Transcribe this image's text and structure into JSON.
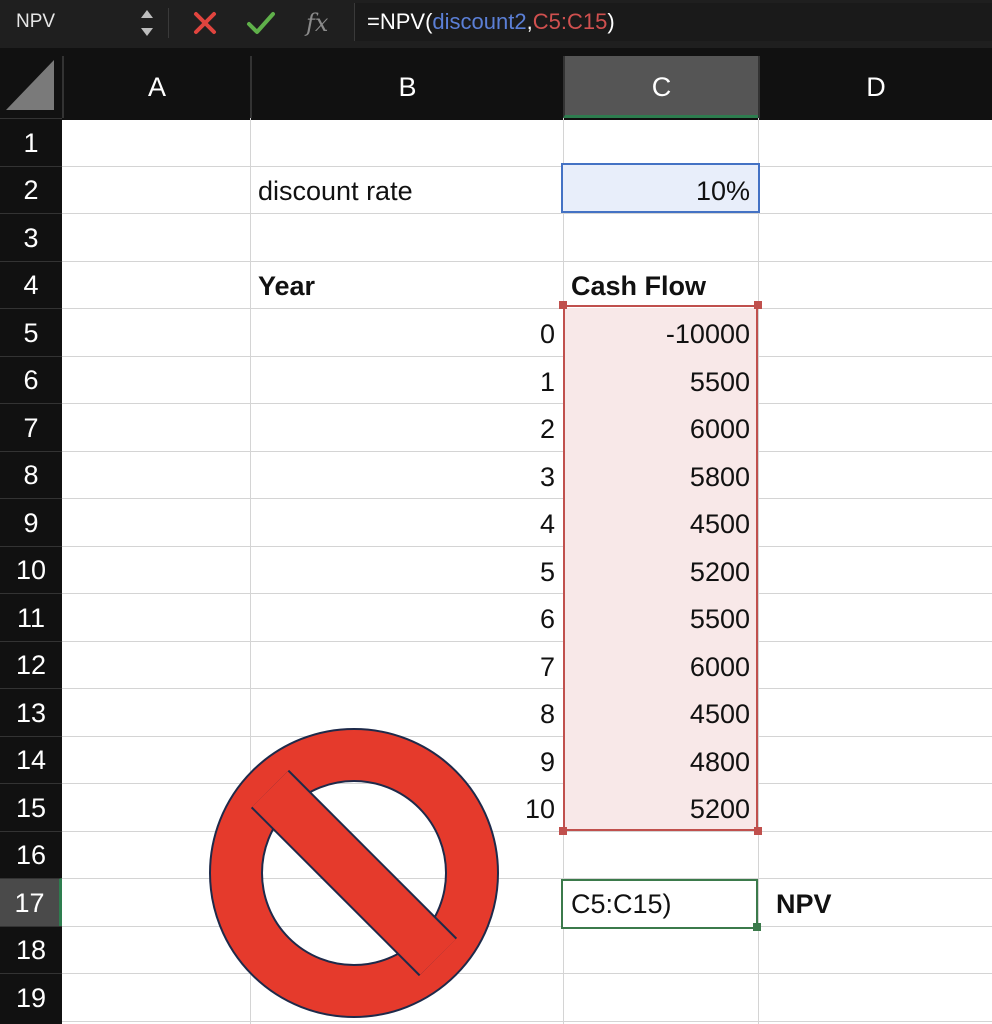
{
  "formula_bar": {
    "name_box": "NPV",
    "formula_prefix": "=NPV(",
    "formula_arg1": "discount2",
    "formula_comma": ",",
    "formula_arg2": "C5:C15",
    "formula_suffix": ")",
    "fx_label": "fx"
  },
  "columns": [
    "A",
    "B",
    "C",
    "D"
  ],
  "rows": [
    "1",
    "2",
    "3",
    "4",
    "5",
    "6",
    "7",
    "8",
    "9",
    "10",
    "11",
    "12",
    "13",
    "14",
    "15",
    "16",
    "17",
    "18",
    "19"
  ],
  "cells": {
    "B2": "discount rate",
    "C2": "10%",
    "B4": "Year",
    "C4": "Cash Flow",
    "C17": "C5:C15)",
    "D17": "NPV"
  },
  "years": [
    "0",
    "1",
    "2",
    "3",
    "4",
    "5",
    "6",
    "7",
    "8",
    "9",
    "10"
  ],
  "cash_flows": [
    "-10000",
    "5500",
    "6000",
    "5800",
    "4500",
    "5200",
    "5500",
    "6000",
    "4500",
    "4800",
    "5200"
  ],
  "icons": {
    "cancel": "cross-icon",
    "enter": "check-icon",
    "overlay": "prohibited-icon"
  },
  "colors": {
    "cancel": "#e0443e",
    "enter": "#5fb04a",
    "ref_blue": "#5b7fd6",
    "ref_red": "#d0504f",
    "prohibited": "#e53a2c",
    "active_cell": "#3b7a4b"
  }
}
